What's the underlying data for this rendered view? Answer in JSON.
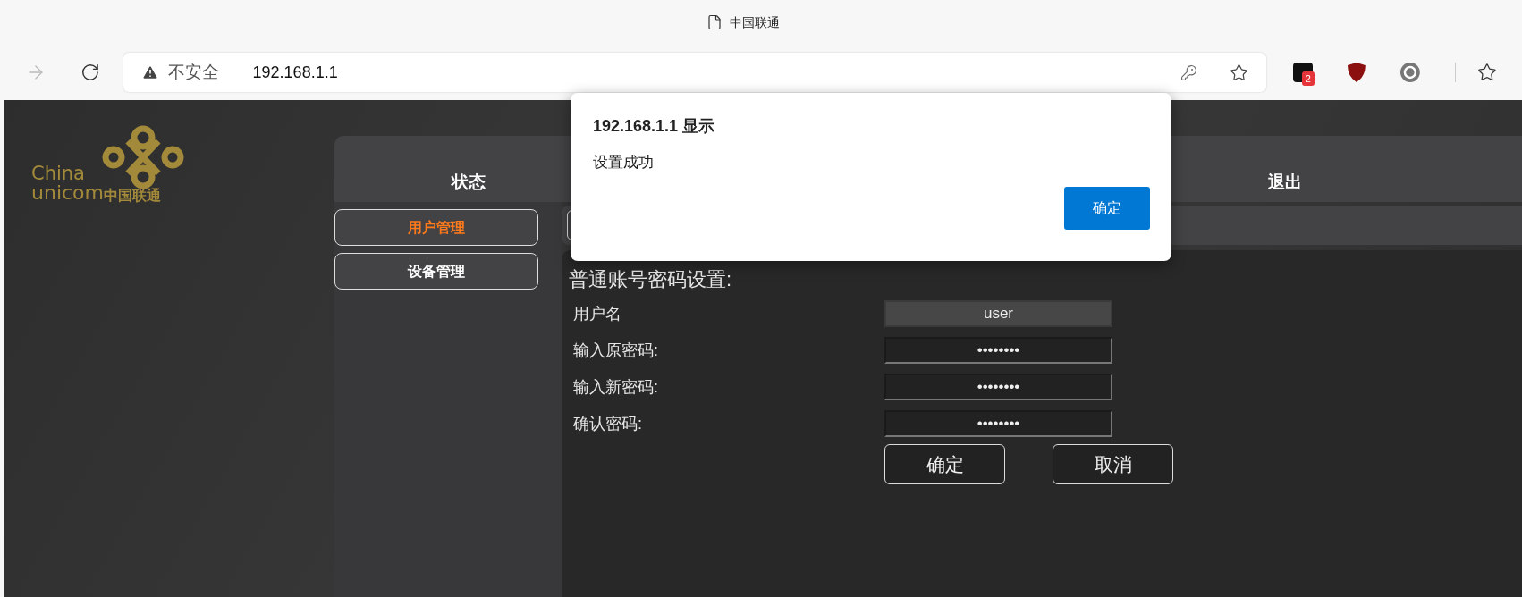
{
  "browser": {
    "tab_title": "中国联通",
    "security_label": "不安全",
    "url": "192.168.1.1",
    "extension_badge": "2"
  },
  "logo": {
    "latin_top": "China",
    "latin_bottom": "unicom",
    "chinese": "中国联通"
  },
  "tabs": [
    {
      "label": "状态"
    },
    {
      "label": "退出"
    }
  ],
  "side_nav": [
    {
      "label": "用户管理",
      "selected": true
    },
    {
      "label": "设备管理",
      "selected": false
    }
  ],
  "form": {
    "title": "普通账号密码设置:",
    "fields": [
      {
        "label": "用户名",
        "value": "user",
        "kind": "text"
      },
      {
        "label": "输入原密码:",
        "value": "••••••••",
        "kind": "password"
      },
      {
        "label": "输入新密码:",
        "value": "••••••••",
        "kind": "password"
      },
      {
        "label": "确认密码:",
        "value": "••••••••",
        "kind": "password"
      }
    ],
    "buttons": [
      "确定",
      "取消"
    ]
  },
  "dialog": {
    "title": "192.168.1.1 显示",
    "message": "设置成功",
    "button": "确定"
  }
}
